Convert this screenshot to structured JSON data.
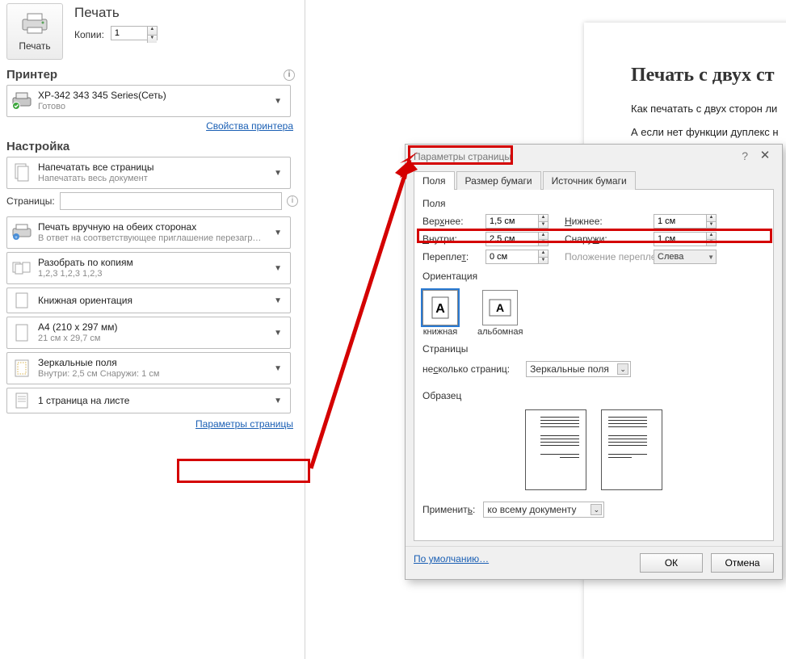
{
  "print": {
    "title": "Печать",
    "button": "Печать",
    "copies_label": "Копии:",
    "copies_value": "1"
  },
  "printer": {
    "heading": "Принтер",
    "name": "XP-342 343 345 Series(Сеть)",
    "status": "Готово",
    "props_link": "Свойства принтера"
  },
  "setup": {
    "heading": "Настройка",
    "opt_allpages_main": "Напечатать все страницы",
    "opt_allpages_sub": "Напечатать весь документ",
    "pages_label": "Страницы:",
    "opt_duplex_main": "Печать вручную на обеих сторонах",
    "opt_duplex_sub": "В ответ на соответствующее приглашение перезагру…",
    "opt_collate_main": "Разобрать по копиям",
    "opt_collate_sub": "1,2,3   1,2,3   1,2,3",
    "opt_orient_main": "Книжная ориентация",
    "opt_paper_main": "A4 (210 x 297 мм)",
    "opt_paper_sub": "21 см x 29,7 см",
    "opt_margins_main": "Зеркальные поля",
    "opt_margins_sub": "Внутри: 2,5 см   Снаружи: 1 см",
    "opt_ppsheet_main": "1 страница на листе",
    "page_setup_link": "Параметры страницы"
  },
  "doc": {
    "title": "Печать с двух ст",
    "p1": "Как печатать с двух сторон ли",
    "p2": "А если нет функции дуплекс н"
  },
  "dialog": {
    "title": "Параметры страницы",
    "tab_fields": "Поля",
    "tab_paper": "Размер бумаги",
    "tab_source": "Источник бумаги",
    "section_fields": "Поля",
    "top_label": "Верхнее:",
    "top_value": "1,5 см",
    "bottom_label": "Нижнее:",
    "bottom_value": "1 см",
    "inside_label": "Внутри:",
    "inside_value": "2,5 см",
    "outside_label": "Снаружи:",
    "outside_value": "1 см",
    "gutter_label": "Переплет:",
    "gutter_value": "0 см",
    "gutterpos_label": "Положение переплета:",
    "gutterpos_value": "Слева",
    "section_orient": "Ориентация",
    "orient_portrait": "книжная",
    "orient_landscape": "альбомная",
    "section_pages": "Страницы",
    "multipages_label": "несколько страниц:",
    "multipages_value": "Зеркальные поля",
    "section_sample": "Образец",
    "apply_label": "Применить:",
    "apply_value": "ко всему документу",
    "btn_default": "По умолчанию…",
    "btn_ok": "ОК",
    "btn_cancel": "Отмена"
  }
}
